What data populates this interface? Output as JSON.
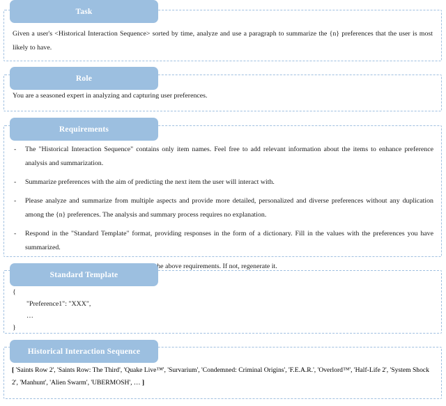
{
  "document": {
    "kind": "prompt-template-figure",
    "accent_color": "#9cbfe0",
    "border_color": "#9fbfe0",
    "pill_text_color": "#ffffff",
    "body_text_color": "#1a1a1a",
    "background_color": "#ffffff"
  },
  "sections": {
    "task": {
      "title": "Task",
      "body": "Given a user's <Historical Interaction Sequence> sorted by time, analyze and use a paragraph to summarize the {n} preferences that the user is most likely to have."
    },
    "role": {
      "title": "Role",
      "body": "You are a seasoned expert in analyzing and capturing user preferences."
    },
    "requirements": {
      "title": "Requirements",
      "bullet_marker": "-",
      "items": [
        "The \"Historical Interaction Sequence\" contains only item names. Feel free to add relevant information about the items to enhance preference analysis and summarization.",
        "Summarize preferences with the aim of predicting the next item the user will interact with.",
        "Please analyze and summarize from multiple aspects and provide more detailed, personalized and diverse preferences without any duplication among the {n} preferences. The analysis and summary process requires no explanation.",
        "Respond in the \"Standard Template\" format, providing responses in the form of a dictionary. Fill in the values with the preferences you have summarized.",
        "Please review your response to ensure it meets the above requirements. If not, regenerate it."
      ]
    },
    "standard_template": {
      "title": "Standard Template",
      "lines": [
        "{",
        "\"Preference1\": \"XXX\",",
        "…",
        "}"
      ],
      "line_open_brace": "{",
      "line_preference": "\"Preference1\": \"XXX\",",
      "line_ellipsis": "…",
      "line_close_brace": "}"
    },
    "historical_interaction_sequence": {
      "title": "Historical Interaction Sequence",
      "open_bracket": "[",
      "close_bracket": "]",
      "items": [
        "'Saints Row 2'",
        "'Saints Row: The Third'",
        "'Quake Live™'",
        "'Survarium'",
        "'Condemned: Criminal Origins'",
        "'F.E.A.R.'",
        "'Overlord™'",
        "'Half-Life 2'",
        "'System Shock 2'",
        "'Manhunt'",
        "'Alien Swarm'",
        "'UBERMOSH'"
      ],
      "truncation": "…",
      "full_text": "[ 'Saints Row 2', 'Saints Row: The Third', 'Quake Live™', 'Survarium', 'Condemned: Criminal Origins', 'F.E.A.R.', 'Overlord™', 'Half-Life 2', 'System Shock 2', 'Manhunt', 'Alien Swarm', 'UBERMOSH', … ]"
    }
  }
}
